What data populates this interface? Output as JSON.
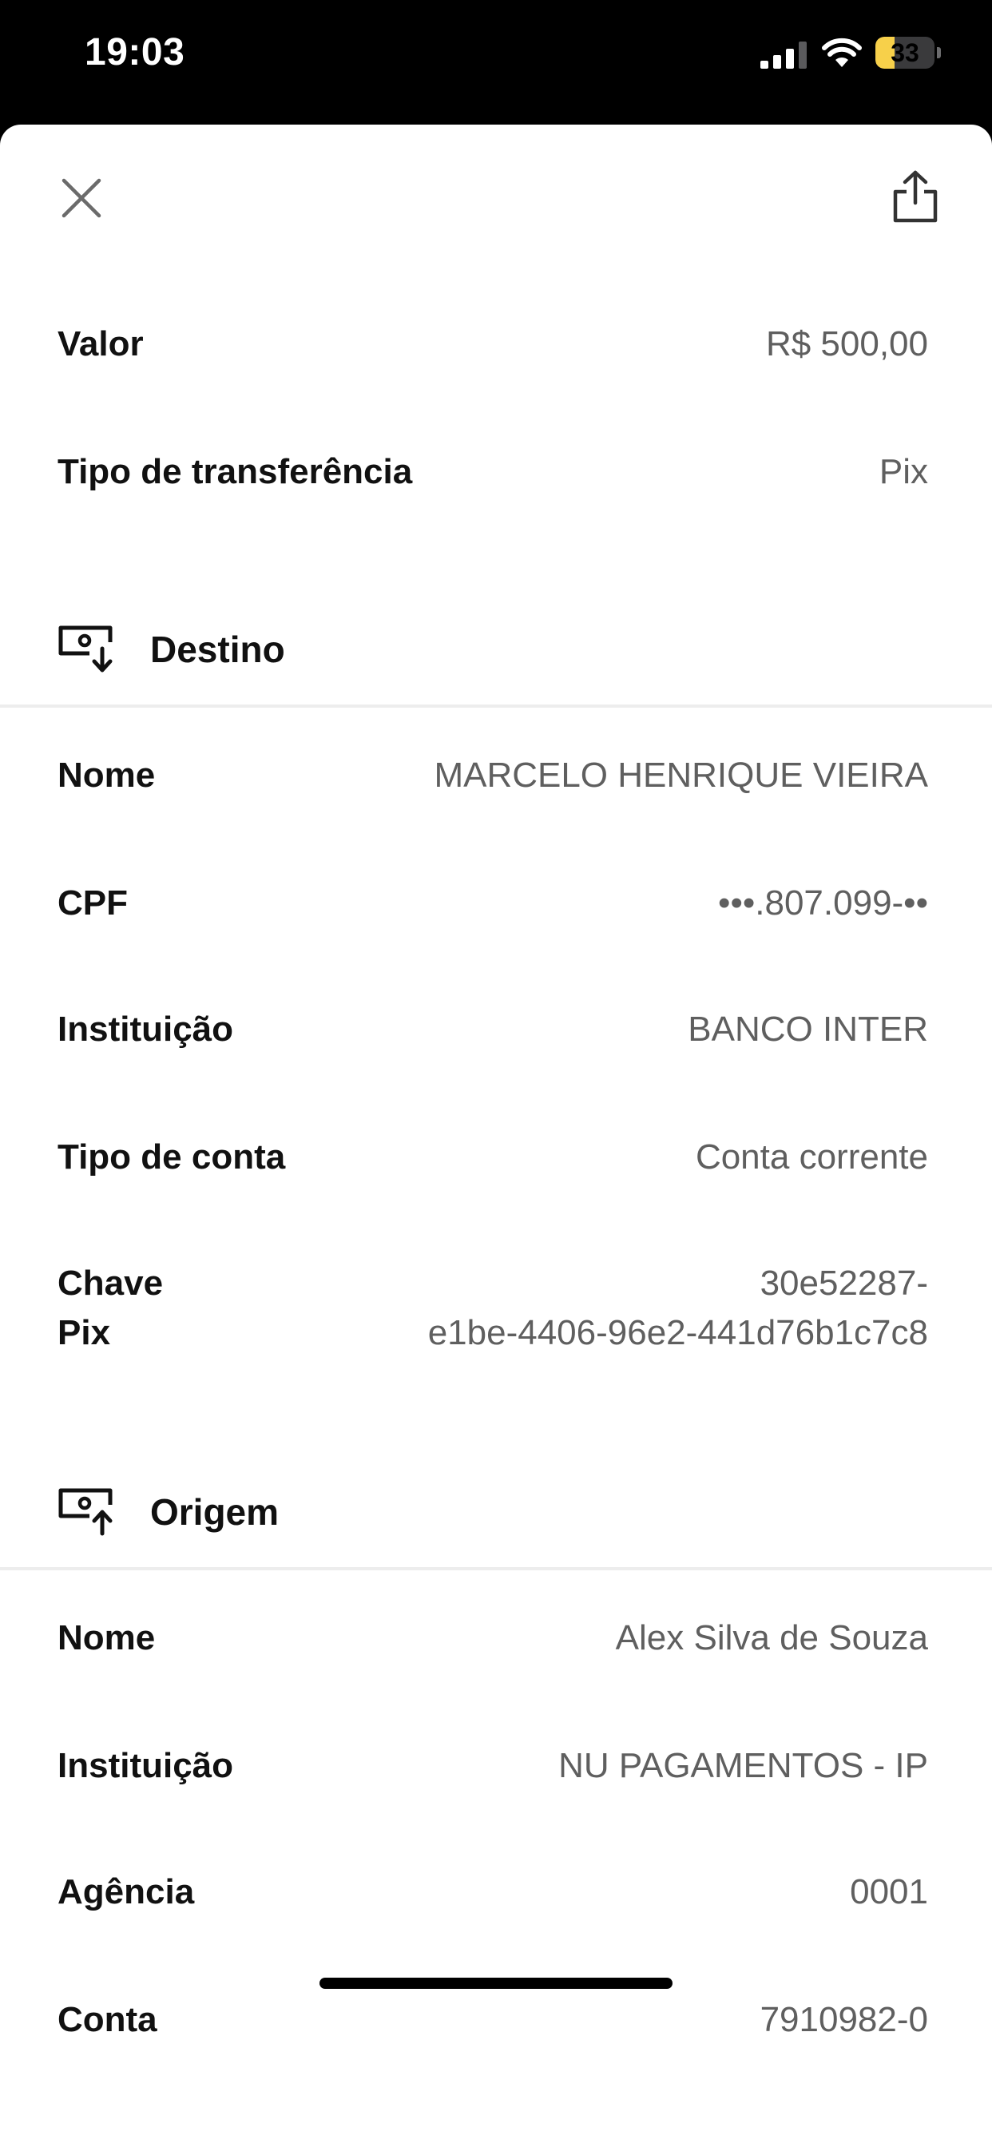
{
  "status_bar": {
    "time": "19:03",
    "battery_level": "33",
    "battery_fraction": 0.33,
    "icons": [
      "signal-icon",
      "wifi-icon",
      "battery-icon"
    ]
  },
  "toolbar": {
    "close_icon": "close-icon",
    "share_icon": "share-icon"
  },
  "summary": [
    {
      "label": "Valor",
      "value": "R$ 500,00"
    },
    {
      "label": "Tipo de transferência",
      "value": "Pix"
    }
  ],
  "destino": {
    "title": "Destino",
    "icon": "money-in-icon",
    "rows": [
      {
        "label": "Nome",
        "value": "MARCELO HENRIQUE VIEIRA"
      },
      {
        "label": "CPF",
        "value": "•••.807.099-••"
      },
      {
        "label": "Instituição",
        "value": "BANCO INTER"
      },
      {
        "label": "Tipo de conta",
        "value": "Conta corrente"
      }
    ],
    "pix_key": {
      "label_line1": "Chave",
      "label_line2": "Pix",
      "value_line1": "30e52287-",
      "value_line2": "e1be-4406-96e2-441d76b1c7c8"
    }
  },
  "origem": {
    "title": "Origem",
    "icon": "money-out-icon",
    "rows": [
      {
        "label": "Nome",
        "value": "Alex Silva de Souza"
      },
      {
        "label": "Instituição",
        "value": "NU PAGAMENTOS - IP"
      },
      {
        "label": "Agência",
        "value": "0001"
      },
      {
        "label": "Conta",
        "value": "7910982-0"
      }
    ]
  },
  "colors": {
    "label": "#111111",
    "value": "#5f5f5f",
    "divider": "#ededed",
    "battery": "#f7d04a"
  }
}
